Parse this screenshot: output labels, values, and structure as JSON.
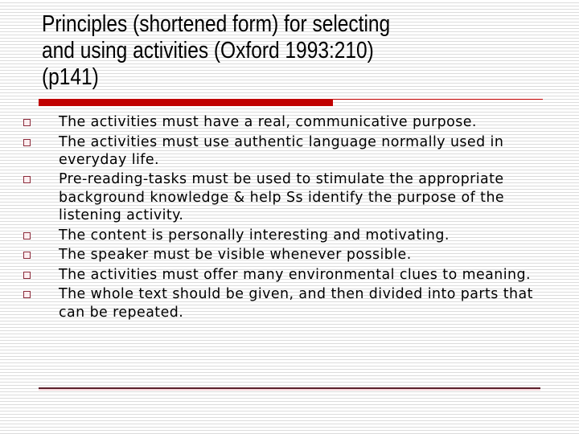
{
  "slide": {
    "title": "Principles (shortened form) for selecting\nand using activities (Oxford 1993:210)\n(p141)",
    "accent_color": "#c00000",
    "bullet_marker_icon": "hollow-square",
    "bullets": [
      {
        "text": "The activities must have a real, communicative purpose."
      },
      {
        "text": "The activities must use authentic language normally used in everyday life."
      },
      {
        "text": "Pre-reading-tasks must be used to stimulate the appropriate background knowledge & help Ss identify the purpose of the listening activity."
      },
      {
        "text": "The content is personally interesting and motivating."
      },
      {
        "text": "The speaker must be visible whenever possible."
      },
      {
        "text": "The activities must offer many environmental clues to meaning."
      },
      {
        "text": "The whole text should be given, and then divided into parts that can be repeated."
      }
    ]
  }
}
